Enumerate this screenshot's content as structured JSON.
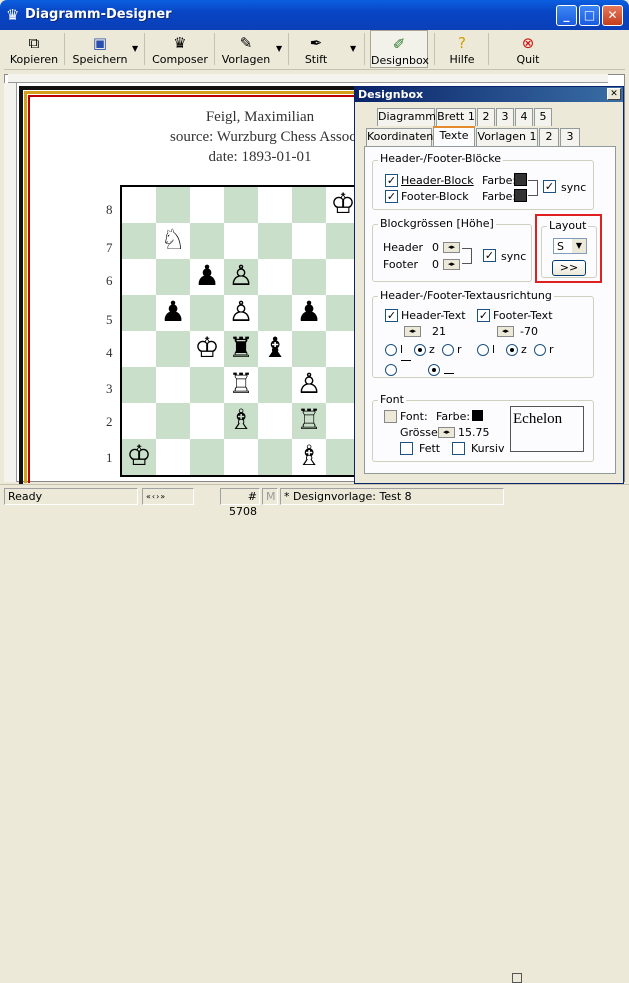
{
  "window": {
    "title": "Diagramm-Designer"
  },
  "toolbar": {
    "kopieren": "Kopieren",
    "speichern": "Speichern",
    "composer": "Composer",
    "vorlagen": "Vorlagen",
    "stift": "Stift",
    "designbox": "Designbox",
    "hilfe": "Hilfe",
    "quit": "Quit"
  },
  "diagram": {
    "header_line1": "Feigl, Maximilian",
    "header_line2": "source: Wurzburg Chess Associat",
    "header_line3": "date: 1893-01-01",
    "ranks": [
      "8",
      "7",
      "6",
      "5",
      "4",
      "3",
      "2",
      "1"
    ]
  },
  "designbox": {
    "title": "Designbox",
    "tabs_row1": [
      "Diagramm",
      "Brett 1",
      "2",
      "3",
      "4",
      "5"
    ],
    "tabs_row2": [
      "Koordinaten",
      "Texte",
      "Vorlagen 1",
      "2",
      "3"
    ],
    "group_blocks": {
      "label": "Header-/Footer-Blöcke",
      "header_block": "Header-Block",
      "footer_block": "Footer-Block",
      "farbe1": "Farbe:",
      "farbe2": "Farbe:",
      "sync": "sync"
    },
    "group_sizes": {
      "label": "Blockgrössen [Höhe]",
      "header": "Header",
      "footer": "Footer",
      "header_value": "0",
      "footer_value": "0",
      "sync": "sync"
    },
    "group_layout": {
      "label": "Layout",
      "select_value": "S",
      "more_button": ">>"
    },
    "group_align": {
      "label": "Header-/Footer-Textausrichtung",
      "header_text": "Header-Text",
      "footer_text": "Footer-Text",
      "header_value": "21",
      "footer_value": "-70",
      "r_l": "l",
      "r_z": "z",
      "r_r": "r",
      "r2_l": "l",
      "r2_z": "z",
      "r2_r": "r"
    },
    "group_font": {
      "label": "Font",
      "font": "Font:",
      "farbe": "Farbe:",
      "groesse": "Grösse",
      "size_value": "15.75",
      "fett": "Fett",
      "kursiv": "Kursiv",
      "preview": "Echelon"
    }
  },
  "status": {
    "ready": "Ready",
    "counter": "# 5708",
    "m": "M",
    "template": "* Designvorlage: Test 8"
  },
  "colors": {
    "title_bar": "#0845c4",
    "board_light": "#ffffff",
    "board_dark": "#c9dfc9",
    "highlight": "#e02020"
  }
}
